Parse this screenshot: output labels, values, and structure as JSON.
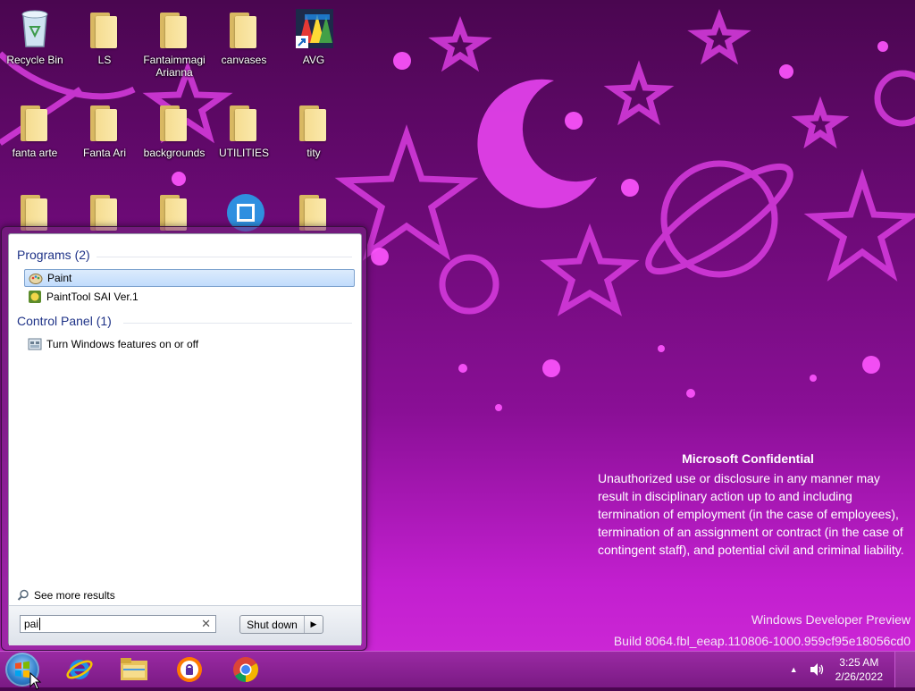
{
  "desktop": {
    "icons": [
      {
        "label": "Recycle Bin",
        "icon": "recycle-bin-icon"
      },
      {
        "label": "LS",
        "icon": "folder-icon"
      },
      {
        "label": "Fantaimmagi Arianna",
        "icon": "folder-icon"
      },
      {
        "label": "canvases",
        "icon": "folder-icon"
      },
      {
        "label": "AVG",
        "icon": "avg-icon"
      },
      {
        "label": "fanta arte",
        "icon": "folder-icon"
      },
      {
        "label": "Fanta Ari",
        "icon": "folder-icon"
      },
      {
        "label": "backgrounds",
        "icon": "folder-icon"
      },
      {
        "label": "UTILITIES",
        "icon": "folder-icon"
      },
      {
        "label": "tity",
        "icon": "folder-icon"
      }
    ]
  },
  "start_menu": {
    "groups": [
      {
        "title": "Programs (2)",
        "items": [
          {
            "label": "Paint",
            "icon": "paint-icon",
            "selected": true
          },
          {
            "label": "PaintTool SAI Ver.1",
            "icon": "painttool-sai-icon"
          }
        ]
      },
      {
        "title": "Control Panel (1)",
        "items": [
          {
            "label": "Turn Windows features on or off",
            "icon": "windows-features-icon"
          }
        ]
      }
    ],
    "see_more": "See more results",
    "search_value": "pai",
    "shutdown_label": "Shut down"
  },
  "confidential": {
    "title": "Microsoft Confidential",
    "body": "Unauthorized use or disclosure in any manner may result in disciplinary action up to and including termination of employment (in the case of employees), termination of an assignment or contract (in the case of contingent staff), and potential civil and criminal liability."
  },
  "watermark": {
    "edition": "Windows Developer Preview",
    "build": "Build 8064.fbl_eeap.110806-1000.959cf95e18056cd0"
  },
  "taskbar": {
    "pinned": [
      "internet-explorer-icon",
      "file-explorer-icon",
      "avast-browser-icon",
      "chrome-icon"
    ],
    "clock_time": "3:25 AM",
    "clock_date": "2/26/2022"
  },
  "colors": {
    "wallpaper_magenta": "#d02ad8",
    "wallpaper_dark": "#4a0650",
    "accent_pink": "#e040e8"
  }
}
